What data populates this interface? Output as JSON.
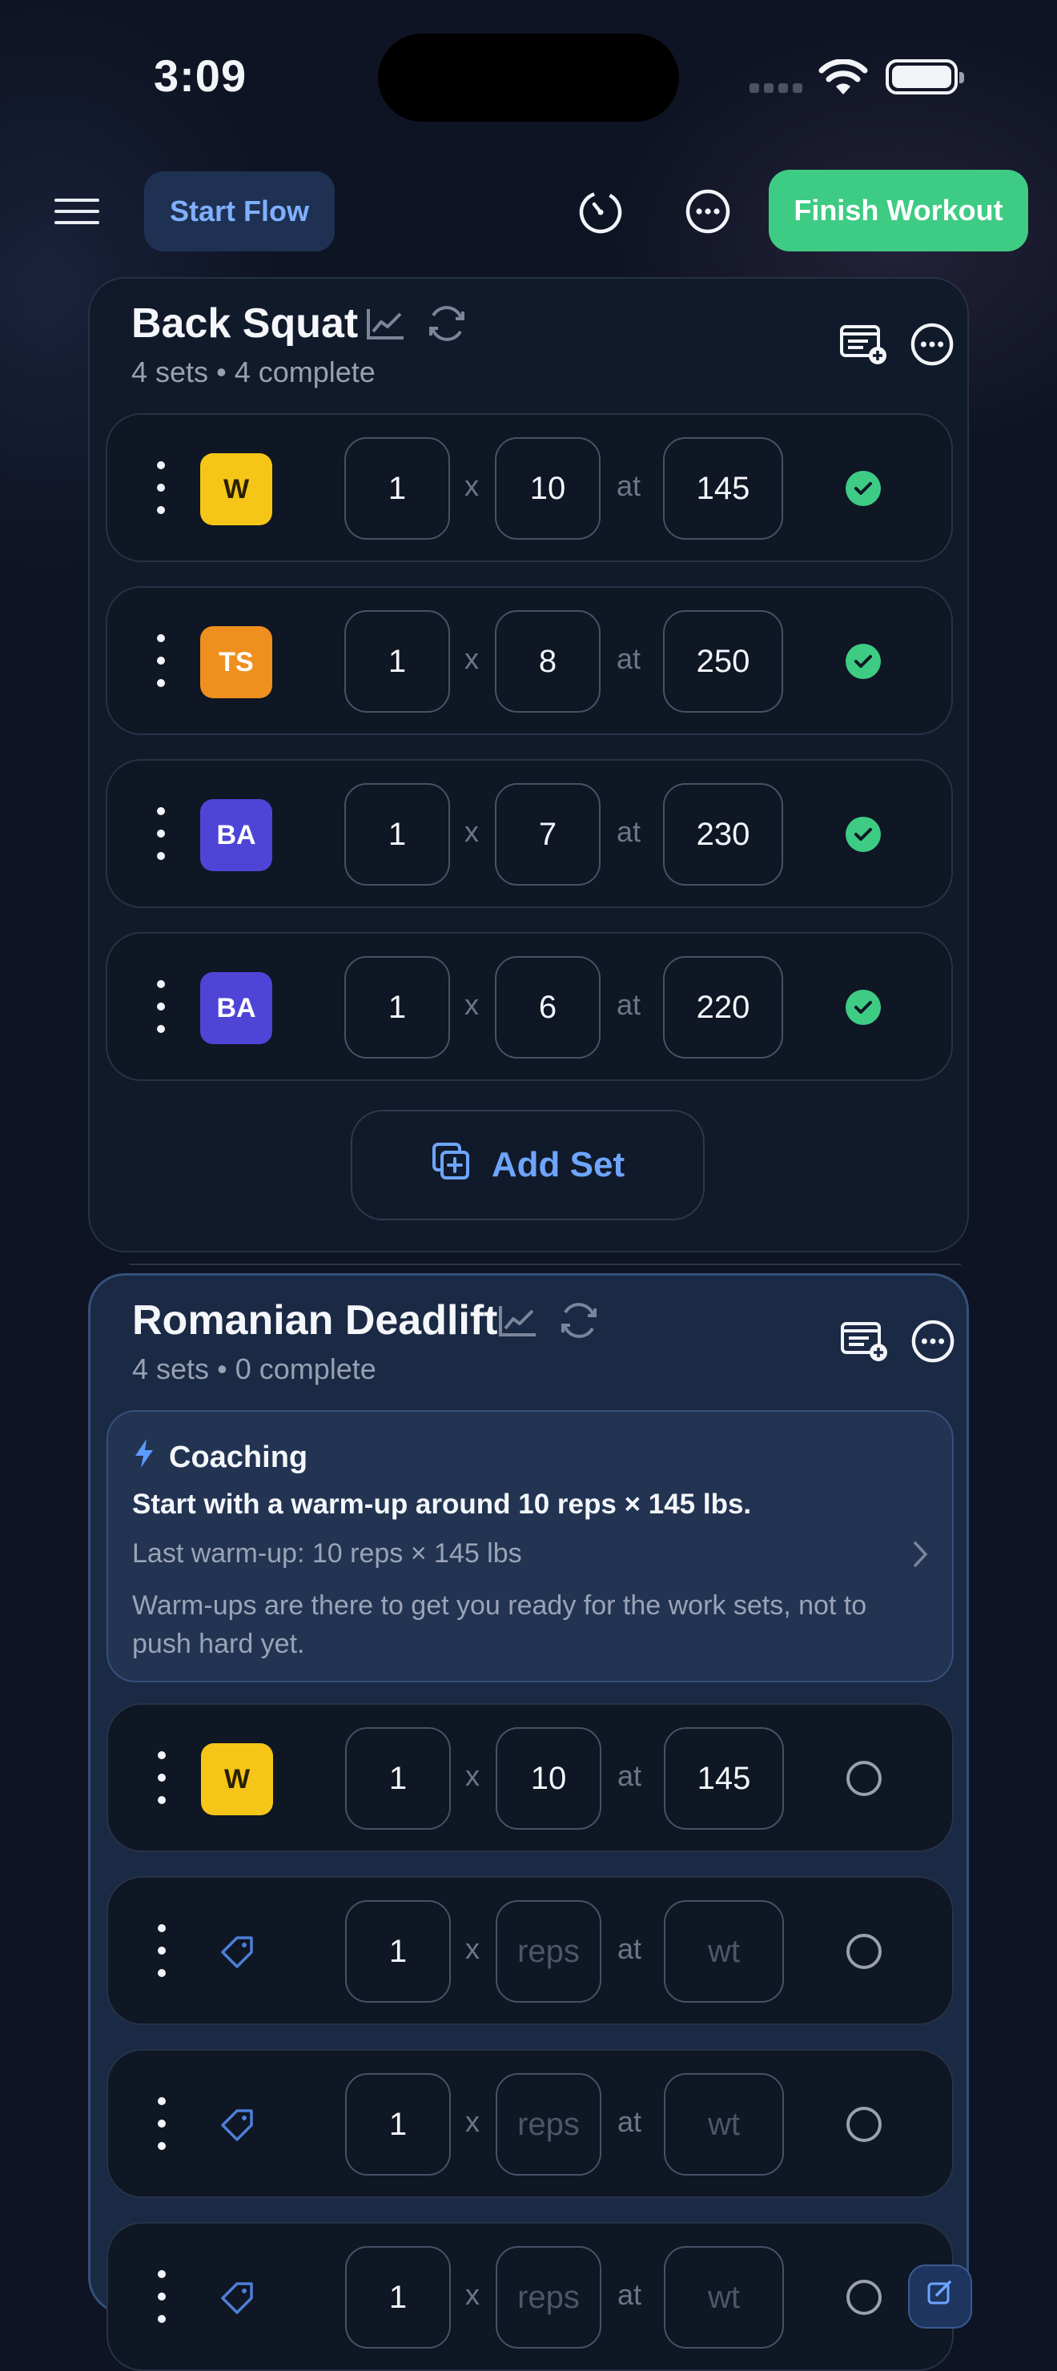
{
  "status_bar": {
    "time": "3:09"
  },
  "toolbar": {
    "start_flow_label": "Start Flow",
    "finish_label": "Finish Workout",
    "menu_icon": "hamburger-icon",
    "timer_icon": "timer-icon",
    "more_icon": "more-icon"
  },
  "exercises": [
    {
      "name": "Back Squat",
      "sets_count": "4 sets",
      "separator": "•",
      "complete": "4 complete",
      "sets": [
        {
          "tag": "W",
          "count": "1",
          "reps": "10",
          "weight": "145",
          "done": true
        },
        {
          "tag": "TS",
          "count": "1",
          "reps": "8",
          "weight": "250",
          "done": true
        },
        {
          "tag": "BA",
          "count": "1",
          "reps": "7",
          "weight": "230",
          "done": true
        },
        {
          "tag": "BA",
          "count": "1",
          "reps": "6",
          "weight": "220",
          "done": true
        }
      ],
      "add_set_label": "Add Set"
    },
    {
      "name": "Romanian Deadlift",
      "sets_count": "4 sets",
      "separator": "•",
      "complete": "0 complete",
      "coaching": {
        "title": "Coaching",
        "headline": "Start with a warm-up around 10 reps × 145 lbs.",
        "last": "Last warm-up: 10 reps × 145 lbs",
        "note": "Warm-ups are there to get you ready for the work sets, not to push hard yet."
      },
      "sets": [
        {
          "tag": "W",
          "count": "1",
          "reps": "10",
          "weight": "145",
          "done": false
        },
        {
          "tag": "",
          "count": "1",
          "reps_placeholder": "reps",
          "weight_placeholder": "wt",
          "done": false
        },
        {
          "tag": "",
          "count": "1",
          "reps_placeholder": "reps",
          "weight_placeholder": "wt",
          "done": false
        },
        {
          "tag": "",
          "count": "1",
          "reps_placeholder": "reps",
          "weight_placeholder": "wt",
          "done": false
        }
      ]
    }
  ],
  "labels": {
    "x": "x",
    "at": "at"
  },
  "colors": {
    "accent_green": "#3ecb84",
    "accent_blue": "#6ea5ff",
    "tag_warmup": "#f5c518",
    "tag_ts": "#ee8f1e",
    "tag_ba": "#4e45d6"
  }
}
